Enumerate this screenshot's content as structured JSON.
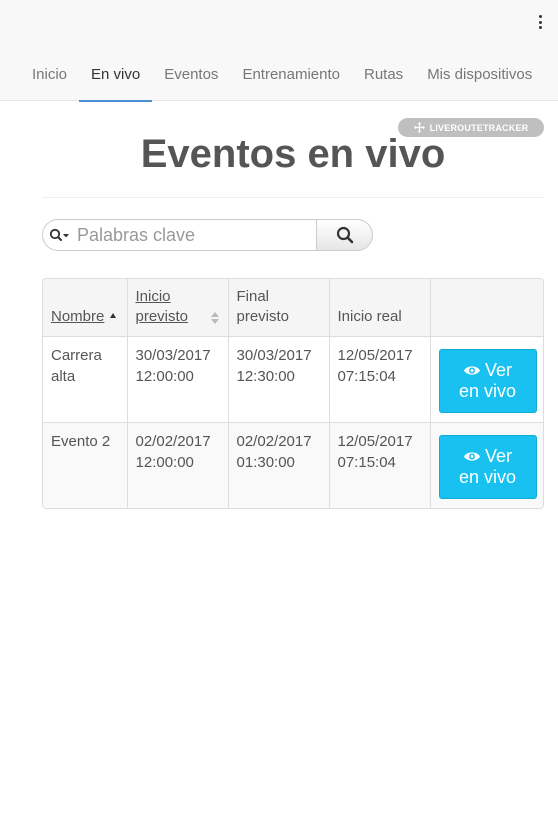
{
  "nav": {
    "menu_icon": "kebab-menu-icon",
    "tabs": [
      {
        "label": "Inicio",
        "active": false
      },
      {
        "label": "En vivo",
        "active": true
      },
      {
        "label": "Eventos",
        "active": false
      },
      {
        "label": "Entrenamiento",
        "active": false
      },
      {
        "label": "Rutas",
        "active": false
      },
      {
        "label": "Mis dispositivos",
        "active": false
      }
    ],
    "active_color": "#4a90d9"
  },
  "badge": {
    "label": "LIVEROUTETRACKER",
    "icon": "move-arrows-icon"
  },
  "page": {
    "title": "Eventos en vivo"
  },
  "search": {
    "placeholder": "Palabras clave",
    "value": ""
  },
  "table": {
    "headers": {
      "name": "Nombre",
      "start_planned": "Inicio previsto",
      "end_planned": "Final previsto",
      "start_real": "Inicio real"
    },
    "rows": [
      {
        "name": "Carrera alta",
        "start_planned": "30/03/2017 12:00:00",
        "end_planned": "30/03/2017 12:30:00",
        "start_real": "12/05/2017 07:15:04",
        "action_line1": "Ver",
        "action_line2": "en vivo"
      },
      {
        "name": "Evento 2",
        "start_planned": "02/02/2017 12:00:00",
        "end_planned": "02/02/2017 01:30:00",
        "start_real": "12/05/2017 07:15:04",
        "action_line1": "Ver",
        "action_line2": "en vivo"
      }
    ],
    "action_color": "#18c1ef"
  }
}
